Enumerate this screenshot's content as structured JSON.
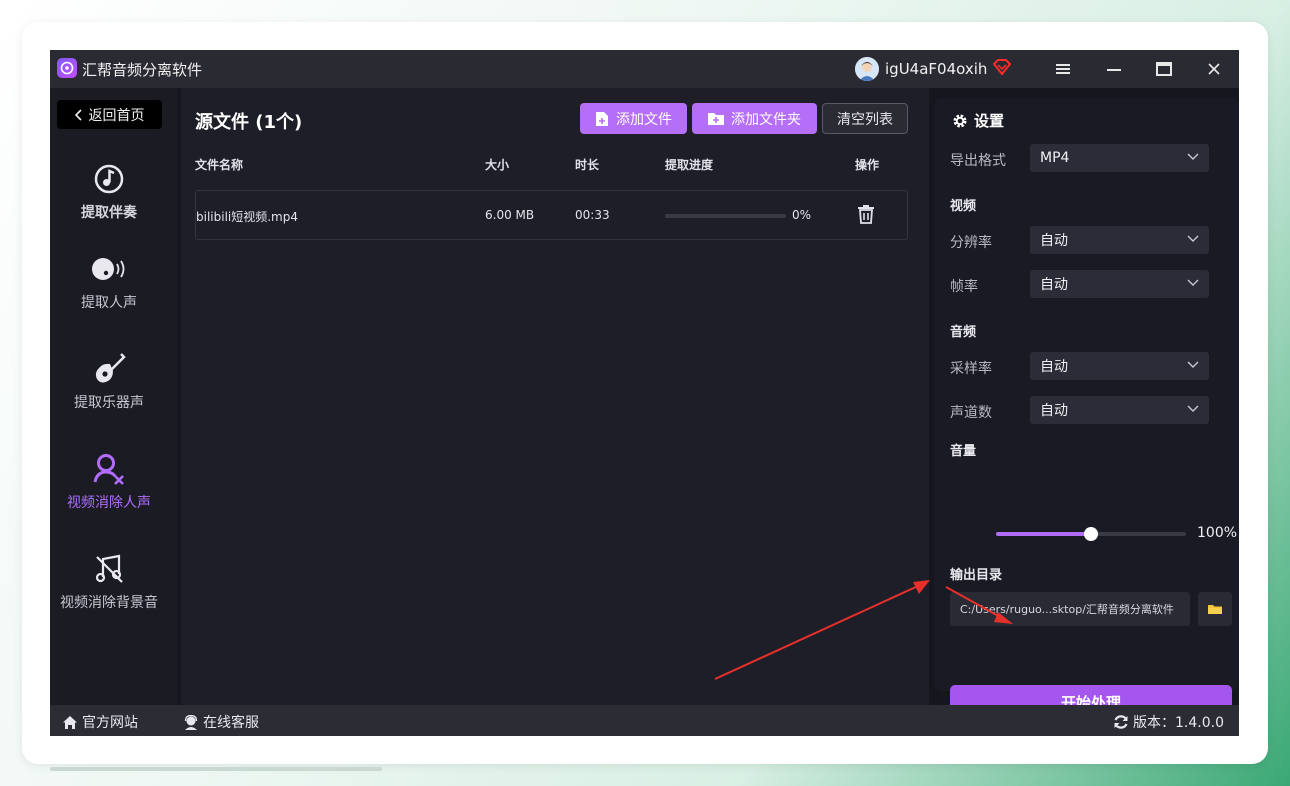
{
  "titlebar": {
    "app_title": "汇帮音频分离软件",
    "username": "igU4aF04oxih"
  },
  "sidebar": {
    "back_label": "返回首页",
    "items": [
      {
        "label": "提取伴奏",
        "icon": "music-note-icon"
      },
      {
        "label": "提取人声",
        "icon": "voice-icon"
      },
      {
        "label": "提取乐器声",
        "icon": "guitar-icon"
      },
      {
        "label": "视频消除人声",
        "icon": "user-remove-icon"
      },
      {
        "label": "视频消除背景音",
        "icon": "music-mute-icon"
      }
    ]
  },
  "main": {
    "title": "源文件 (1个)",
    "add_file_label": "添加文件",
    "add_folder_label": "添加文件夹",
    "clear_label": "清空列表",
    "columns": {
      "name": "文件名称",
      "size": "大小",
      "duration": "时长",
      "progress": "提取进度",
      "action": "操作"
    },
    "files": [
      {
        "name": "bilibili短视频.mp4",
        "size": "6.00 MB",
        "duration": "00:33",
        "progress_text": "0%",
        "progress": 0
      }
    ]
  },
  "settings": {
    "title": "设置",
    "export_format_label": "导出格式",
    "export_format": "MP4",
    "video_section": "视频",
    "resolution_label": "分辨率",
    "resolution": "自动",
    "framerate_label": "帧率",
    "framerate": "自动",
    "audio_section": "音频",
    "samplerate_label": "采样率",
    "samplerate": "自动",
    "channels_label": "声道数",
    "channels": "自动",
    "volume_label": "音量",
    "volume_text": "100%",
    "volume_fraction": 0.5,
    "output_dir_label": "输出目录",
    "output_dir": "C:/Users/ruguo...sktop/汇帮音频分离软件",
    "start_label": "开始处理"
  },
  "footer": {
    "website": "官方网站",
    "support": "在线客服",
    "version": "版本：1.4.0.0"
  },
  "colors": {
    "accent": "#b56ef7",
    "start_button": "#a556ef",
    "annotation_arrow": "#e8302a"
  }
}
